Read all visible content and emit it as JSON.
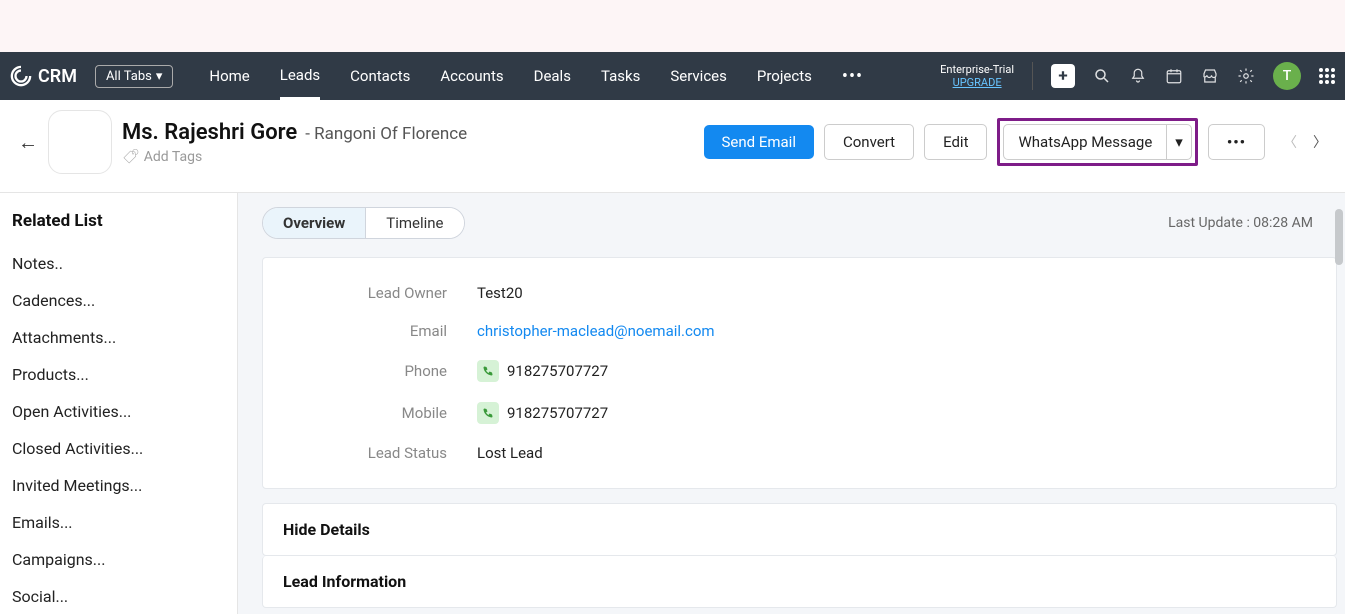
{
  "brand": "CRM",
  "allTabsLabel": "All Tabs",
  "nav": [
    {
      "label": "Home"
    },
    {
      "label": "Leads"
    },
    {
      "label": "Contacts"
    },
    {
      "label": "Accounts"
    },
    {
      "label": "Deals"
    },
    {
      "label": "Tasks"
    },
    {
      "label": "Services"
    },
    {
      "label": "Projects"
    }
  ],
  "trial": {
    "line1": "Enterprise-Trial",
    "upgrade": "UPGRADE"
  },
  "avatarLetter": "T",
  "lead": {
    "name": "Ms. Rajeshri Gore",
    "company": "Rangoni Of Florence",
    "addTags": "Add Tags"
  },
  "actions": {
    "sendEmail": "Send Email",
    "convert": "Convert",
    "edit": "Edit",
    "whatsapp": "WhatsApp Message",
    "more": "•••"
  },
  "relatedList": {
    "title": "Related List",
    "items": [
      "Notes..",
      "Cadences...",
      "Attachments...",
      "Products...",
      "Open Activities...",
      "Closed Activities...",
      "Invited Meetings...",
      "Emails...",
      "Campaigns...",
      "Social..."
    ]
  },
  "tabs": {
    "overview": "Overview",
    "timeline": "Timeline"
  },
  "lastUpdate": "Last Update : 08:28 AM",
  "fields": {
    "leadOwnerLabel": "Lead Owner",
    "leadOwner": "Test20",
    "emailLabel": "Email",
    "email": "christopher-maclead@noemail.com",
    "phoneLabel": "Phone",
    "phone": "918275707727",
    "mobileLabel": "Mobile",
    "mobile": "918275707727",
    "leadStatusLabel": "Lead Status",
    "leadStatus": "Lost Lead"
  },
  "sections": {
    "hideDetails": "Hide Details",
    "leadInformation": "Lead Information"
  }
}
